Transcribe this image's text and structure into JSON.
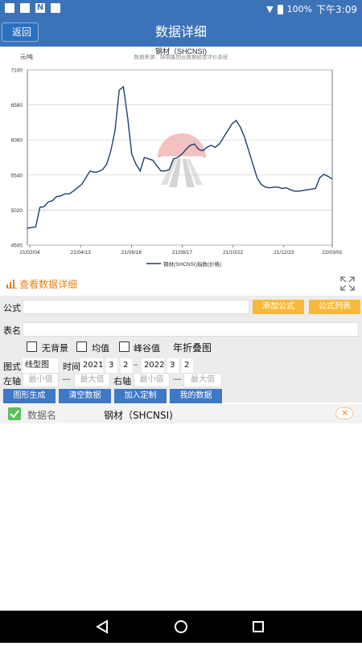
{
  "status": {
    "battery": "100%",
    "time": "下午3:09",
    "notif_n": "N"
  },
  "header": {
    "back_label": "返回",
    "title": "数据详细"
  },
  "chart_data": {
    "type": "line",
    "title": "钢材（SHCNSI)",
    "subtitle": "数据来源：陕钢集团云数据经营评价系统",
    "ylabel": "元/吨",
    "ylim": [
      4500,
      7100
    ],
    "yticks": [
      4500,
      5020,
      5540,
      6060,
      6580,
      7100
    ],
    "xticks": [
      "21/02/04",
      "21/04/13",
      "21/06/16",
      "21/08/17",
      "21/10/22",
      "21/12/23",
      "22/03/01"
    ],
    "legend": "钢材(SHCNSI)指数(价格)",
    "legend_position": "bottom",
    "grid": true,
    "color": "#1f3f6e",
    "series": [
      {
        "name": "钢材(SHCNSI)指数(价格)",
        "values": [
          4750,
          4760,
          4770,
          5060,
          5070,
          5140,
          5160,
          5220,
          5230,
          5260,
          5260,
          5300,
          5350,
          5400,
          5500,
          5600,
          5580,
          5590,
          5620,
          5700,
          5900,
          6200,
          6800,
          6850,
          6400,
          5850,
          5700,
          5600,
          5800,
          5780,
          5760,
          5680,
          5600,
          5600,
          5620,
          5780,
          5800,
          5850,
          5920,
          5980,
          6000,
          5920,
          5900,
          5950,
          5980,
          5950,
          6000,
          6100,
          6200,
          6300,
          6350,
          6250,
          6100,
          5900,
          5700,
          5500,
          5400,
          5360,
          5350,
          5360,
          5360,
          5340,
          5350,
          5320,
          5300,
          5300,
          5310,
          5320,
          5330,
          5340,
          5500,
          5550,
          5520,
          5480
        ]
      }
    ]
  },
  "detail_bar": {
    "label": "查看数据详细"
  },
  "form": {
    "formula_label": "公式",
    "add_formula": "添加公式",
    "formula_list": "公式列表",
    "table_label": "表名",
    "checks": [
      "无背景",
      "均值",
      "峰谷值"
    ],
    "fold_label": "年折叠图",
    "chart_style_label": "图式",
    "chart_style_value": "线型图",
    "time_label": "时间",
    "start_year": "2021",
    "start_month": "3",
    "start_day": "2",
    "end_year": "2022",
    "end_month": "3",
    "end_day": "2",
    "left_axis_label": "左轴",
    "right_axis_label": "右轴",
    "min_placeholder": "最小值",
    "max_placeholder": "最大值",
    "buttons": [
      "图形生成",
      "清空数据",
      "加入定制",
      "我的数据"
    ]
  },
  "list": {
    "header": "数据名",
    "item": "钢材（SHCNSI)"
  }
}
